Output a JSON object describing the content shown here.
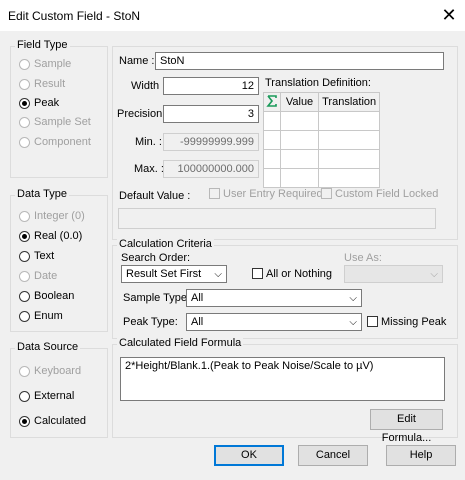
{
  "window": {
    "title": "Edit Custom Field - StoN",
    "close_glyph": "✕"
  },
  "field_type": {
    "legend": "Field Type",
    "options": [
      {
        "label": "Sample",
        "selected": false,
        "enabled": false
      },
      {
        "label": "Result",
        "selected": false,
        "enabled": false
      },
      {
        "label": "Peak",
        "selected": true,
        "enabled": true
      },
      {
        "label": "Sample Set",
        "selected": false,
        "enabled": false
      },
      {
        "label": "Component",
        "selected": false,
        "enabled": false
      }
    ]
  },
  "data_type": {
    "legend": "Data Type",
    "options": [
      {
        "label": "Integer (0)",
        "selected": false,
        "enabled": false
      },
      {
        "label": "Real (0.0)",
        "selected": true,
        "enabled": true
      },
      {
        "label": "Text",
        "selected": false,
        "enabled": true
      },
      {
        "label": "Date",
        "selected": false,
        "enabled": false
      },
      {
        "label": "Boolean",
        "selected": false,
        "enabled": true
      },
      {
        "label": "Enum",
        "selected": false,
        "enabled": true
      }
    ]
  },
  "data_source": {
    "legend": "Data Source",
    "options": [
      {
        "label": "Keyboard",
        "selected": false,
        "enabled": false
      },
      {
        "label": "External",
        "selected": false,
        "enabled": true
      },
      {
        "label": "Calculated",
        "selected": true,
        "enabled": true
      }
    ]
  },
  "props": {
    "name_label": "Name :",
    "name_value": "StoN",
    "width_label": "Width :",
    "width_value": "12",
    "precision_label": "Precision :",
    "precision_value": "3",
    "min_label": "Min. :",
    "min_value": "-99999999.999",
    "max_label": "Max. :",
    "max_value": "100000000.000",
    "default_label": "Default Value :",
    "user_entry_label": "User Entry Required",
    "field_locked_label": "Custom Field Locked",
    "translation_label": "Translation Definition:",
    "translation_headers": [
      "Value",
      "Translation"
    ]
  },
  "calc": {
    "legend": "Calculation Criteria",
    "search_order_label": "Search Order:",
    "search_order_value": "Result Set First",
    "all_or_nothing_label": "All or Nothing",
    "use_as_label": "Use As:",
    "use_as_value": "",
    "sample_type_label": "Sample Type:",
    "sample_type_value": "All",
    "peak_type_label": "Peak Type:",
    "peak_type_value": "All",
    "missing_peak_label": "Missing Peak"
  },
  "formula": {
    "legend": "Calculated Field Formula",
    "text": "2*Height/Blank.1.(Peak to Peak Noise/Scale to µV)",
    "edit_button": "Edit Formula..."
  },
  "buttons": {
    "ok": "OK",
    "cancel": "Cancel",
    "help": "Help"
  },
  "icons": {
    "chevron": "⌵",
    "row_selector": "green-sigma-icon"
  },
  "colors": {
    "default_button_border": "#0078d7",
    "icon_green": "#1a9a5a"
  }
}
